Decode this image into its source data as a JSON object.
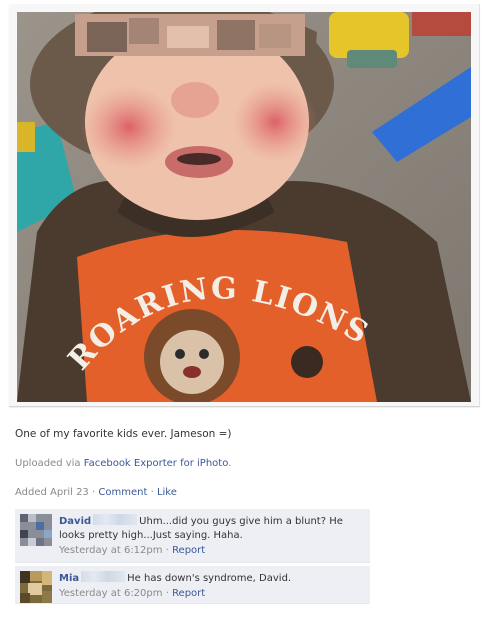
{
  "photo": {
    "shirt_text_line1": "ROARING LIONS",
    "shirt_text_line2": "LIONS"
  },
  "post": {
    "caption": "One of my favorite kids ever. Jameson =)",
    "uploaded_prefix": "Uploaded via ",
    "uploaded_link": "Facebook Exporter for iPhoto",
    "uploaded_suffix": ".",
    "added_label": "Added April 23",
    "separator": "·",
    "comment_link": "Comment",
    "like_link": "Like"
  },
  "comments": [
    {
      "author": "David",
      "text_line1": "Uhm...did you guys give him a blunt? He",
      "text_line2": "looks pretty high...Just saying. Haha.",
      "time": "Yesterday at 6:12pm",
      "report": "Report"
    },
    {
      "author": "Mia",
      "text_line1": "He has down's syndrome, David.",
      "time": "Yesterday at 6:20pm",
      "report": "Report"
    }
  ],
  "colors": {
    "link": "#3b5998",
    "muted": "#8a8a8a",
    "comment_bg": "#edeff4"
  }
}
